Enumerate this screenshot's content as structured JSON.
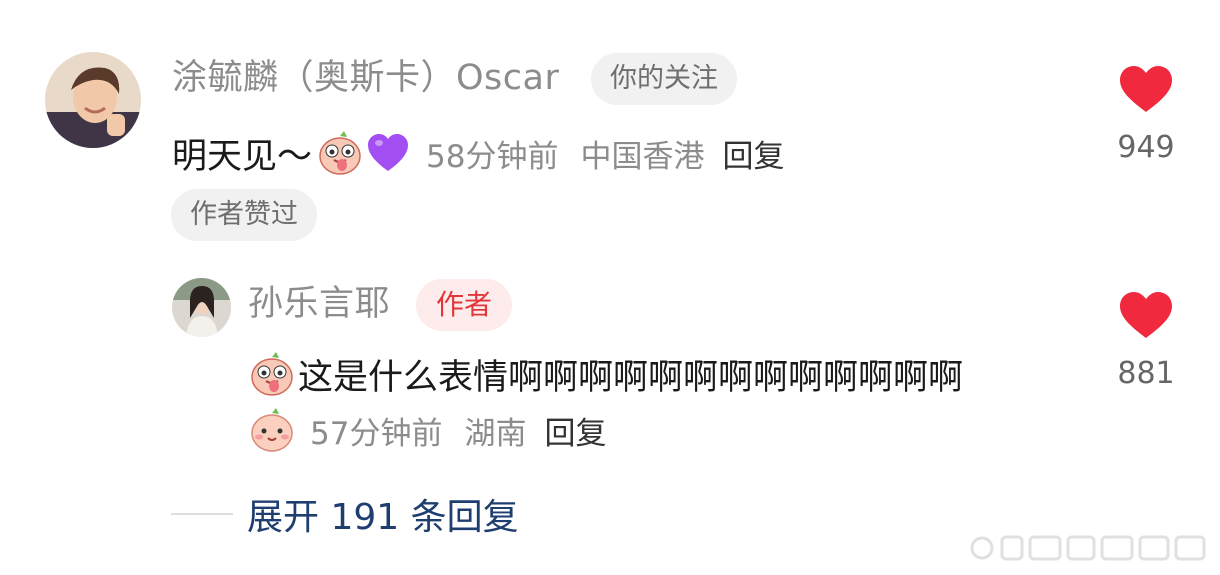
{
  "comment": {
    "username": "涂毓麟（奥斯卡）Oscar",
    "follow_badge": "你的关注",
    "text": "明天见～",
    "time": "58分钟前",
    "location": "中国香港",
    "reply_label": "回复",
    "liked_badge": "作者赞过",
    "like_count": "949",
    "emoji_names": [
      "tongue-face-emoji",
      "purple-heart-emoji"
    ]
  },
  "reply": {
    "username": "孙乐言耶",
    "author_badge": "作者",
    "text": "这是什么表情啊啊啊啊啊啊啊啊啊啊啊啊啊",
    "time": "57分钟前",
    "location": "湖南",
    "reply_label": "回复",
    "like_count": "881",
    "emoji_names": [
      "tongue-face-emoji",
      "smile-face-emoji"
    ]
  },
  "expand": {
    "label": "展开 191 条回复"
  },
  "colors": {
    "like_heart": "#f0293e",
    "author_badge_bg": "#fdeceb",
    "author_badge_text": "#e2363b",
    "expand_link": "#1f3e70",
    "meta_gray": "#8c8c8c"
  },
  "icons": {
    "like": "heart-icon",
    "watermark": "weibo-watermark"
  }
}
